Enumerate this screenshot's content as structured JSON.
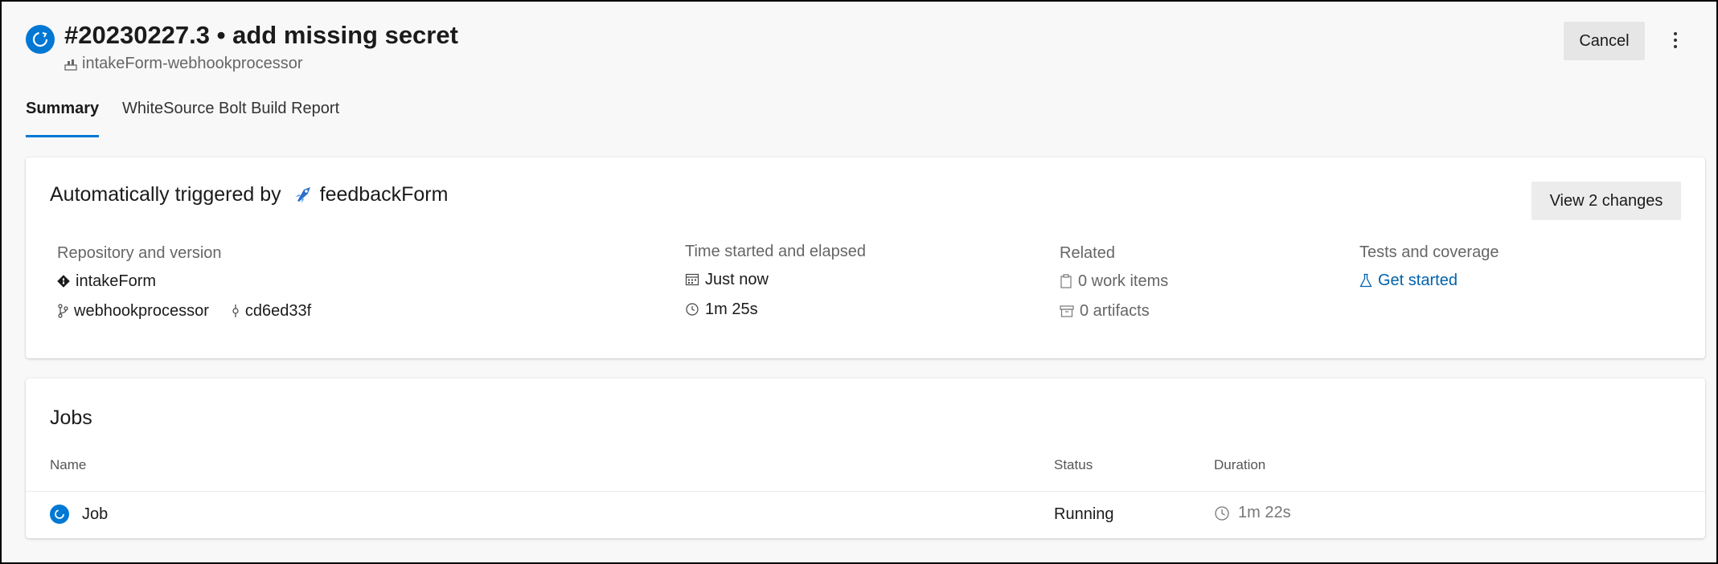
{
  "header": {
    "title": "#20230227.3 • add missing secret",
    "pipeline_name": "intakeForm-webhookprocessor",
    "cancel_label": "Cancel",
    "more_icon": "more-vertical-icon",
    "status_icon": "running-status-icon"
  },
  "tabs": [
    {
      "label": "Summary",
      "active": true
    },
    {
      "label": "WhiteSource Bolt Build Report",
      "active": false
    }
  ],
  "summary": {
    "trigger_prefix": "Automatically triggered by",
    "trigger_source": "feedbackForm",
    "view_changes_label": "View 2 changes",
    "repository": {
      "label": "Repository and version",
      "repo_name": "intakeForm",
      "branch": "webhookprocessor",
      "commit": "cd6ed33f"
    },
    "time": {
      "label": "Time started and elapsed",
      "started": "Just now",
      "elapsed": "1m 25s"
    },
    "related": {
      "label": "Related",
      "work_items": "0 work items",
      "artifacts": "0 artifacts"
    },
    "tests": {
      "label": "Tests and coverage",
      "link": "Get started"
    }
  },
  "jobs": {
    "title": "Jobs",
    "columns": {
      "name": "Name",
      "status": "Status",
      "duration": "Duration"
    },
    "rows": [
      {
        "name": "Job",
        "status": "Running",
        "duration": "1m 22s"
      }
    ]
  },
  "colors": {
    "accent": "#0078d4",
    "link": "#0062ad",
    "background": "#f8f8f8"
  }
}
